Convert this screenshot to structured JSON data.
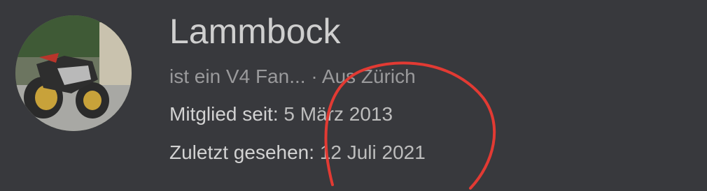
{
  "profile": {
    "username": "Lammbock",
    "tagline": "ist ein V4 Fan...",
    "separator": " · ",
    "location": "Aus Zürich",
    "member_since_label": "Mitglied seit:",
    "member_since_value": "5 März 2013",
    "last_seen_label": "Zuletzt gesehen:",
    "last_seen_value": "12 Juli 2021"
  },
  "colors": {
    "background": "#38393d",
    "annotation_circle": "#e23a33"
  },
  "icons": {
    "avatar": "motorcycle-photo"
  }
}
